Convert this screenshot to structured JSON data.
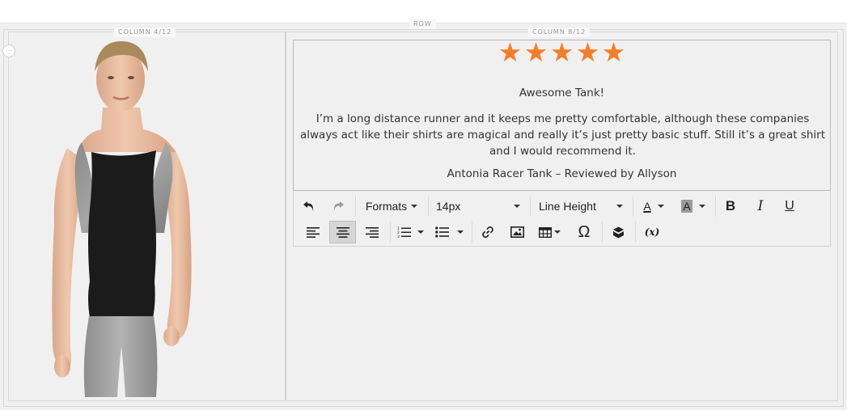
{
  "stage": {
    "row_tag": "ROW",
    "col4_tag": "COLUMN 4/12",
    "col8_tag": "COLUMN 8/12"
  },
  "review": {
    "rating": 5,
    "rating_max": 5,
    "star_color": "#f47e27",
    "stars": [
      "★",
      "★",
      "★",
      "★",
      "★"
    ],
    "title": "Awesome Tank!",
    "body": "I’m a long distance runner and it keeps me pretty comfortable, although these companies always act like their shirts are magical and really it’s just pretty basic stuff. Still it’s a great shirt and I would recommend it.",
    "attribution": "Antonia Racer Tank – Reviewed by Allyson"
  },
  "toolbar": {
    "formats_label": "Formats",
    "font_size_value": "14px",
    "line_height_label": "Line Height",
    "text_color_glyph": "A",
    "bg_color_glyph": "A",
    "bold_glyph": "B",
    "italic_glyph": "I",
    "underline_glyph": "U",
    "special_char_glyph": "Ω",
    "variable_glyph": "(x)",
    "active_align": "center"
  },
  "icons": [
    "undo-icon",
    "redo-icon",
    "align-left-icon",
    "align-center-icon",
    "align-right-icon",
    "numbered-list-icon",
    "bullet-list-icon",
    "link-icon",
    "image-icon",
    "table-icon",
    "widget-icon"
  ]
}
